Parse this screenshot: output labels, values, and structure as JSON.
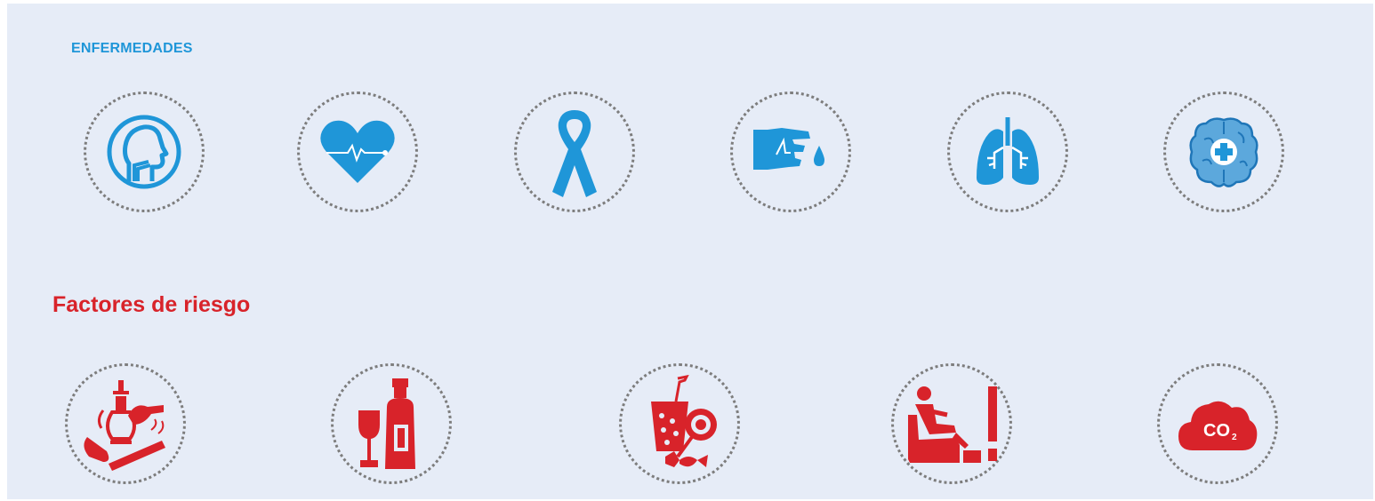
{
  "sections": {
    "diseases": {
      "title": "ENFERMEDADES",
      "color": "#1f96d8",
      "icons": [
        "respiratory-head-icon",
        "heart-pulse-icon",
        "awareness-ribbon-icon",
        "finger-blood-drop-icon",
        "lungs-icon",
        "brain-plus-icon"
      ]
    },
    "risk_factors": {
      "title": "Factores de riesgo",
      "color": "#d8232a",
      "icons": [
        "tobacco-hookah-pipe-cigar-icon",
        "alcohol-bottle-glass-icon",
        "soda-candy-icon",
        "sedentary-armchair-icon",
        "co2-cloud-icon"
      ],
      "co2_label": "CO",
      "co2_subscript": "2"
    }
  }
}
